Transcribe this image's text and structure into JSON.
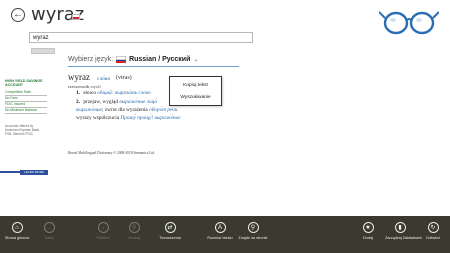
{
  "header": {
    "title": "wyraz",
    "back_icon": "back-arrow-icon",
    "flag": "poland-flag"
  },
  "search": {
    "value": "wyraz",
    "button_label": ""
  },
  "language": {
    "label": "Wybierz język:",
    "flag": "russia-flag",
    "selected": "Russian / Русский"
  },
  "entry": {
    "headword": "wyraz",
    "transliteration": "сло́во",
    "ipa": "(vɨras)",
    "pos": "rzeczownik",
    "gender": "męski",
    "senses": [
      {
        "number": "1.",
        "text": "słowo",
        "russian": "общий: вырази́ть слово"
      },
      {
        "number": "2.",
        "text": "przejaw, wygląd",
        "russian": "выраже́ние лица́",
        "cont1_russian": "выраже́ние",
        "cont1_text": "; zwrot dla wyrażenia",
        "cont1_russian2": "оборо́т речи",
        "cont2_russian": "Прошу́ прощу́! выраже́ние",
        "cont2_text": "wyrazy współczucia"
      }
    ],
    "copyright": "Berzel Multilingual Dictionary © 2000-2018 Semantics Ltd."
  },
  "context_menu": {
    "items": [
      "Kopiuj tekst",
      "Wyszukiwanie"
    ]
  },
  "sidebar_ad": {
    "title": "HIGH YIELD SAVINGS ACCOUNT",
    "links": [
      "Competitive Rate",
      "No Fees",
      "FDIC Insured",
      "No Minimum Balance"
    ],
    "note": "Accounts offered by American Express Bank, FSB. Member FDIC.",
    "button_label": "LEARN MORE"
  },
  "appbar": {
    "left": [
      {
        "label": "Strona główna",
        "icon": "home-icon",
        "enabled": true
      },
      {
        "label": "Dalej",
        "icon": "forward-icon",
        "enabled": false
      },
      {
        "label": "Pobierz",
        "icon": "download-icon",
        "enabled": false
      },
      {
        "label": "Szukaj",
        "icon": "search-icon",
        "enabled": false
      },
      {
        "label": "Tłumaczenia",
        "icon": "translate-icon",
        "enabled": true
      },
      {
        "label": "Rozmiar tekstu",
        "icon": "text-size-icon",
        "enabled": true
      },
      {
        "label": "Znajdź na stronie",
        "icon": "find-icon",
        "enabled": true
      }
    ],
    "right": [
      {
        "label": "Dodaj",
        "icon": "star-icon",
        "enabled": true
      },
      {
        "label": "Zarządzaj Zakładkami",
        "icon": "bookmark-icon",
        "enabled": true
      },
      {
        "label": "Odśwież",
        "icon": "refresh-icon",
        "enabled": true
      }
    ]
  },
  "colors": {
    "appbar": "#3b3a2e",
    "link": "#2b6cb0",
    "ad_green": "#1a7a2f",
    "logo_blue": "#2a6db5"
  }
}
